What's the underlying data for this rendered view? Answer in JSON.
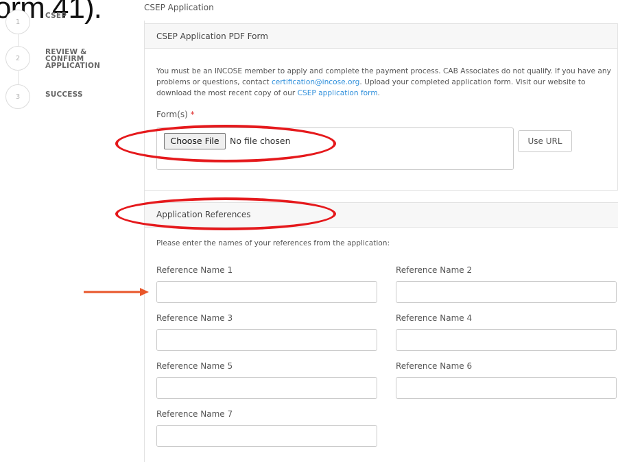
{
  "overlay_text": "orm 41).",
  "steps": [
    {
      "number": "1",
      "label": "CSEP"
    },
    {
      "number": "2",
      "label": "REVIEW & CONFIRM APPLICATION"
    },
    {
      "number": "3",
      "label": "SUCCESS"
    }
  ],
  "page_title": "CSEP Application",
  "pdf_panel": {
    "header": "CSEP Application PDF Form",
    "intro_before_email": "You must be an INCOSE member to apply and complete the payment process.  CAB Associates do not qualify. If you have any problems or questions, contact ",
    "email": "certification@incose.org",
    "intro_after_email": ".  Upload your completed application form. Visit our website to download the most recent copy of our ",
    "form_link": "CSEP application form",
    "intro_end": ".",
    "forms_label": "Form(s)",
    "required_mark": "*",
    "choose_file_label": "Choose File",
    "no_file_text": "No file chosen",
    "use_url_label": "Use URL"
  },
  "references_panel": {
    "header": "Application References",
    "intro": "Please enter the names of your references from the application:",
    "fields": [
      {
        "label": "Reference Name 1",
        "value": ""
      },
      {
        "label": "Reference Name 2",
        "value": ""
      },
      {
        "label": "Reference Name 3",
        "value": ""
      },
      {
        "label": "Reference Name 4",
        "value": ""
      },
      {
        "label": "Reference Name 5",
        "value": ""
      },
      {
        "label": "Reference Name 6",
        "value": ""
      },
      {
        "label": "Reference Name 7",
        "value": ""
      }
    ]
  },
  "colors": {
    "annotation_ellipse": "#e5191c",
    "annotation_arrow": "#e8562a",
    "link": "#2f8fdb"
  }
}
